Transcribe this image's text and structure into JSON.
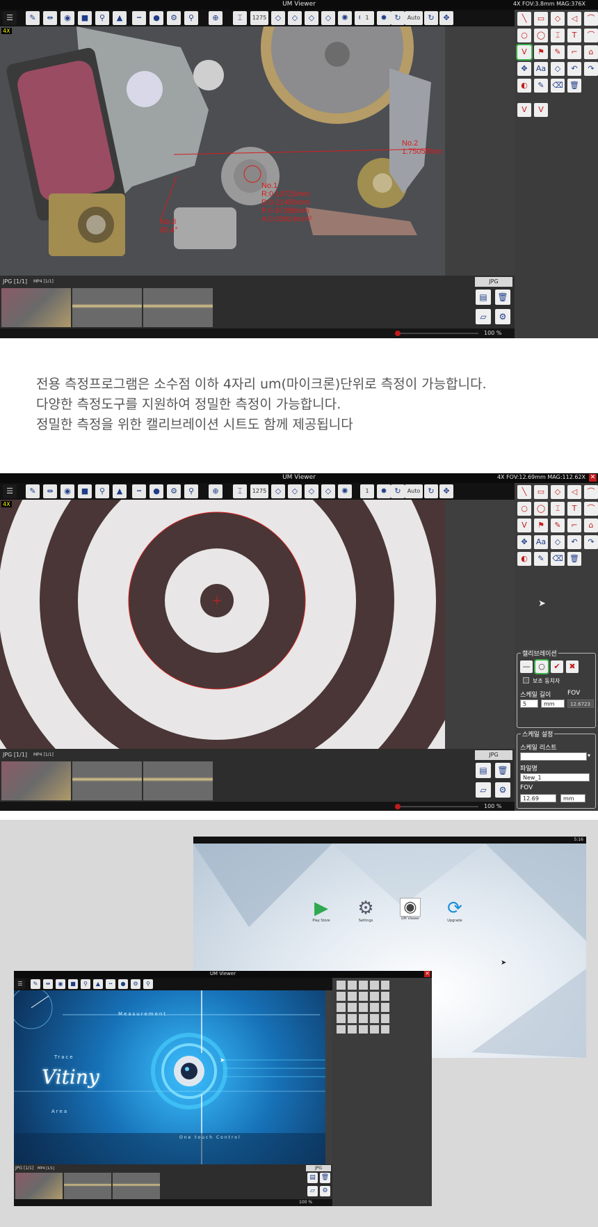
{
  "description": {
    "line1": "전용 측정프로그램은 소수점 이하 4자리 um(마이크론)단위로 측정이 가능합니다.",
    "line2": "다양한 측정도구를 지원하여 정밀한 측정이 가능합니다.",
    "line3": "정밀한 측정을 위한 캘리브레이션 시트도 함께 제공됩니다"
  },
  "app1": {
    "status": "4X  FOV:3.8mm  MAG:376X",
    "zoom_badge": "4X",
    "annotations": {
      "no2": [
        "No.2",
        "1.75056mm"
      ],
      "no1": [
        "No.1",
        "R:0.10725mm",
        "D:0.21450mm",
        "P:0.67388mm",
        "A:0.03614mm²"
      ],
      "no3": [
        "No.3",
        "65.4°"
      ]
    }
  },
  "app2": {
    "status": "4X  FOV:12.69mm  MAG:112.62X",
    "zoom_badge": "4X",
    "calib": {
      "title": "캘리브레이션",
      "assist": "보조 동치자",
      "scale_len_label": "스케일 길이",
      "fov_label": "FOV",
      "scale_len": "5",
      "unit": "mm",
      "fov_value": "12.6723",
      "scale_settings": "스케일 설정",
      "scale_list": "스케일 리스트",
      "filename_label": "파일명",
      "filename": "New_1",
      "fov2_label": "FOV",
      "fov2": "12.69",
      "unit2": "mm"
    }
  },
  "common": {
    "title": "UM Viewer",
    "tab_jpg": "JPG [1/1]",
    "tab_mp4": "MP4 [1/1]",
    "format": "JPG",
    "zoom": "100 %",
    "counter": "1275",
    "num": "1",
    "auto": "Auto",
    "close": "✕"
  },
  "desktop": {
    "clock": "5:16",
    "apps": [
      "Play Store",
      "Settings",
      "UM Viewer",
      "Upgrade"
    ]
  },
  "app3": {
    "labels": {
      "measurement": "Measurement",
      "trace": "Trace",
      "area": "Area",
      "logo": "Vitiny",
      "sub": "One touch Control"
    }
  },
  "colors": {
    "accent": "#1e3c88",
    "measure": "#d61d1d",
    "panel_bg": "#3f3f3f",
    "title_bg": "#0b0b0b",
    "page_bg": "#d9d9d9"
  }
}
